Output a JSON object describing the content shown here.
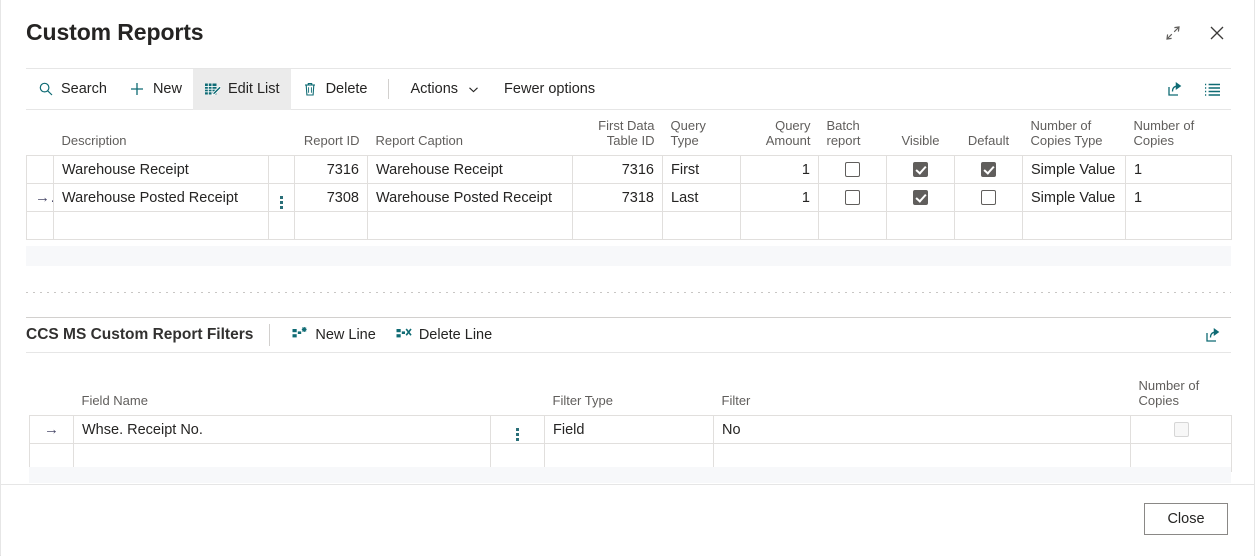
{
  "window": {
    "title": "Custom Reports",
    "restore_icon": "restore-down-icon",
    "close_icon": "close-icon"
  },
  "toolbar": {
    "items": [
      {
        "label": "Search",
        "icon": "search-icon",
        "state": "normal"
      },
      {
        "label": "New",
        "icon": "plus-icon",
        "state": "normal"
      },
      {
        "label": "Edit List",
        "icon": "edit-list-icon",
        "state": "active"
      },
      {
        "label": "Delete",
        "icon": "trash-icon",
        "state": "normal"
      }
    ],
    "actions_label": "Actions",
    "actions_chevron": "chevron-down-icon",
    "fewer_options_label": "Fewer options",
    "share_icon": "share-icon",
    "list_icon": "list-view-icon"
  },
  "grid_reports": {
    "columns": [
      {
        "header": "Description",
        "align": "left"
      },
      {
        "header": "Report ID",
        "align": "right"
      },
      {
        "header": "Report Caption",
        "align": "left"
      },
      {
        "header": "First Data\nTable ID",
        "align": "right"
      },
      {
        "header": "Query\nType",
        "align": "left"
      },
      {
        "header": "Query\nAmount",
        "align": "right"
      },
      {
        "header": "Batch\nreport",
        "align": "center"
      },
      {
        "header": "Visible",
        "align": "center"
      },
      {
        "header": "Default",
        "align": "center"
      },
      {
        "header": "Number of\nCopies Type",
        "align": "left"
      },
      {
        "header": "Number of\nCopies",
        "align": "left"
      }
    ],
    "header_description": "Description",
    "header_report_id": "Report ID",
    "header_report_caption": "Report Caption",
    "header_first_data_table_id_l1": "First Data",
    "header_first_data_table_id_l2": "Table ID",
    "header_query_type_l1": "Query",
    "header_query_type_l2": "Type",
    "header_query_amount_l1": "Query",
    "header_query_amount_l2": "Amount",
    "header_batch_report_l1": "Batch",
    "header_batch_report_l2": "report",
    "header_visible": "Visible",
    "header_default": "Default",
    "header_copies_type_l1": "Number of",
    "header_copies_type_l2": "Copies Type",
    "header_copies_l1": "Number of",
    "header_copies_l2": "Copies",
    "rows": [
      {
        "selected": false,
        "indicator": "",
        "description": "Warehouse Receipt",
        "report_id": "7316",
        "report_caption": "Warehouse Receipt",
        "first_data_table_id": "7316",
        "query_type": "First",
        "query_amount": "1",
        "batch_report": false,
        "visible": true,
        "default": true,
        "copies_type": "Simple Value",
        "copies": "1"
      },
      {
        "selected": true,
        "indicator": "→",
        "description": "Warehouse Posted Receipt",
        "report_id": "7308",
        "report_caption": "Warehouse Posted Receipt",
        "first_data_table_id": "7318",
        "query_type": "Last",
        "query_amount": "1",
        "batch_report": false,
        "visible": true,
        "default": false,
        "copies_type": "Simple Value",
        "copies": "1"
      }
    ]
  },
  "subsection": {
    "title": "CCS MS Custom Report Filters",
    "new_line_label": "New Line",
    "new_line_icon": "new-line-icon",
    "delete_line_label": "Delete Line",
    "delete_line_icon": "delete-line-icon",
    "share_icon": "share-icon"
  },
  "grid_filters": {
    "header_field_name": "Field Name",
    "header_filter_type": "Filter Type",
    "header_filter": "Filter",
    "header_copies_l1": "Number of",
    "header_copies_l2": "Copies",
    "rows": [
      {
        "selected": true,
        "indicator": "→",
        "field_name": "Whse. Receipt No.",
        "filter_type": "Field",
        "filter": "No",
        "copies_checkbox": "disabled"
      }
    ]
  },
  "footer": {
    "close_label": "Close"
  },
  "colors": {
    "accent_teal": "#0f6b74",
    "selected_cell": "#b6e4e8",
    "header_text": "#605e5c",
    "grid_line": "#e1dfdd"
  }
}
